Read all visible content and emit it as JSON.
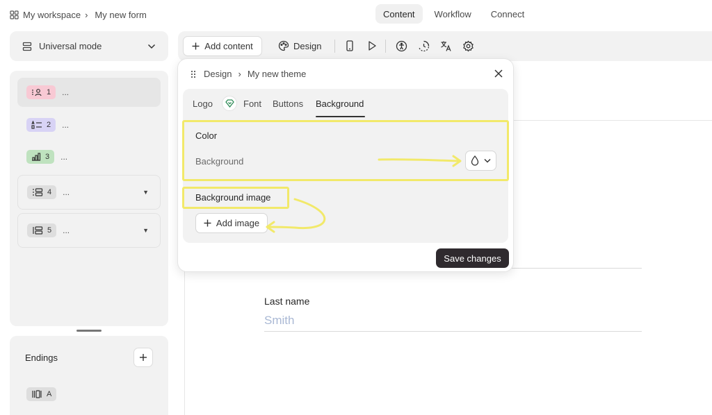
{
  "breadcrumb": {
    "workspace": "My workspace",
    "form": "My new form"
  },
  "topnav": [
    "Content",
    "Workflow",
    "Connect"
  ],
  "sidebar": {
    "mode": "Universal mode",
    "questions": [
      {
        "number": "1",
        "text": "...",
        "icon": "contact-icon",
        "color": "#f8c9d4"
      },
      {
        "number": "2",
        "text": "...",
        "icon": "list-icon",
        "color": "#d8d3f5"
      },
      {
        "number": "3",
        "text": "...",
        "icon": "bar-chart-icon",
        "color": "#bfe2bf"
      },
      {
        "number": "4",
        "text": "...",
        "icon": "group-icon",
        "color": "#dedede"
      },
      {
        "number": "5",
        "text": "...",
        "icon": "group-alt-icon",
        "color": "#dedede"
      }
    ],
    "endings_title": "Endings",
    "ending_badge": "A"
  },
  "toolbar": {
    "add_content": "Add content",
    "design": "Design"
  },
  "panel": {
    "crumb_design": "Design",
    "crumb_theme": "My new theme",
    "tabs": [
      "Logo",
      "Font",
      "Buttons",
      "Background"
    ],
    "active_tab": "Background",
    "color_title": "Color",
    "background_label": "Background",
    "bg_image_title": "Background image",
    "add_image": "Add image",
    "save": "Save changes"
  },
  "form": {
    "last_name_label": "Last name",
    "last_name_placeholder": "Smith"
  },
  "colors": {
    "highlight": "#f2e96a",
    "save_button": "#2f2a2e",
    "placeholder": "#a9b8d4"
  }
}
